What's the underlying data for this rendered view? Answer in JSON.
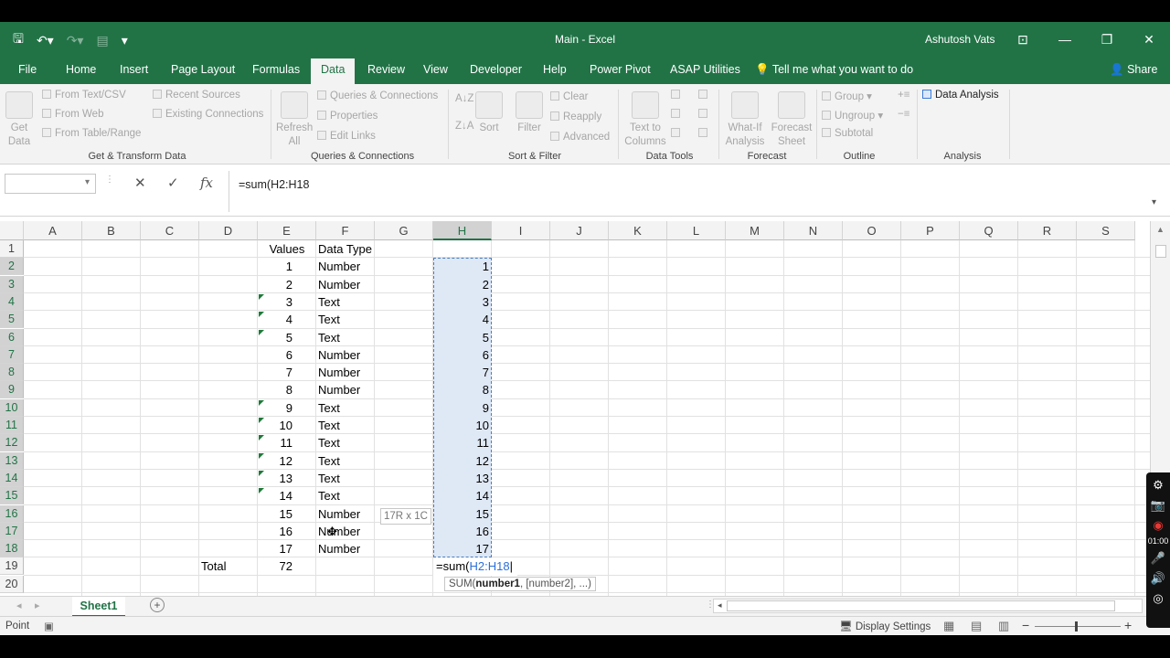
{
  "window": {
    "title": "Main  -  Excel",
    "user": "Ashutosh Vats"
  },
  "tabs": [
    "File",
    "Home",
    "Insert",
    "Page Layout",
    "Formulas",
    "Data",
    "Review",
    "View",
    "Developer",
    "Help",
    "Power Pivot",
    "ASAP Utilities"
  ],
  "active_tab": "Data",
  "tell_me": "Tell me what you want to do",
  "share": "Share",
  "ribbon": {
    "get_data": "Get Data",
    "from_text_csv": "From Text/CSV",
    "from_web": "From Web",
    "from_table_range": "From Table/Range",
    "recent_sources": "Recent Sources",
    "existing_connections": "Existing Connections",
    "group_get_transform": "Get & Transform Data",
    "refresh_all": "Refresh All",
    "queries_connections": "Queries & Connections",
    "properties": "Properties",
    "edit_links": "Edit Links",
    "group_queries": "Queries & Connections",
    "sort": "Sort",
    "filter": "Filter",
    "clear": "Clear",
    "reapply": "Reapply",
    "advanced": "Advanced",
    "group_sort_filter": "Sort & Filter",
    "text_to_columns": "Text to Columns",
    "group_data_tools": "Data Tools",
    "what_if": "What-If Analysis",
    "forecast_sheet": "Forecast Sheet",
    "group_forecast": "Forecast",
    "group": "Group",
    "ungroup": "Ungroup",
    "subtotal": "Subtotal",
    "group_outline": "Outline",
    "data_analysis": "Data Analysis",
    "group_analysis": "Analysis"
  },
  "formula_bar": {
    "name_box": "",
    "fx": "fx",
    "formula": "=sum(H2:H18"
  },
  "columns": [
    "A",
    "B",
    "C",
    "D",
    "E",
    "F",
    "G",
    "H",
    "I",
    "J",
    "K",
    "L",
    "M",
    "N",
    "O",
    "P",
    "Q",
    "R",
    "S"
  ],
  "rows": [
    "1",
    "2",
    "3",
    "4",
    "5",
    "6",
    "7",
    "8",
    "9",
    "10",
    "11",
    "12",
    "13",
    "14",
    "15",
    "16",
    "17",
    "18",
    "19",
    "20"
  ],
  "sheet": {
    "header_values": "Values",
    "header_type": "Data Type",
    "values": [
      "1",
      "2",
      "3",
      "4",
      "5",
      "6",
      "7",
      "8",
      "9",
      "10",
      "11",
      "12",
      "13",
      "14",
      "15",
      "16",
      "17"
    ],
    "types": [
      "Number",
      "Number",
      "Text",
      "Text",
      "Text",
      "Number",
      "Number",
      "Number",
      "Text",
      "Text",
      "Text",
      "Text",
      "Text",
      "Text",
      "Number",
      "Number",
      "Number"
    ],
    "text_flags": [
      false,
      false,
      true,
      true,
      true,
      false,
      false,
      false,
      true,
      true,
      true,
      true,
      true,
      true,
      false,
      false,
      false
    ],
    "h_values": [
      "1",
      "2",
      "3",
      "4",
      "5",
      "6",
      "7",
      "8",
      "9",
      "10",
      "11",
      "12",
      "13",
      "14",
      "15",
      "16",
      "17"
    ],
    "total_label": "Total",
    "total_value": "72",
    "edit_prefix": "=sum(",
    "edit_ref": "H2:H18"
  },
  "selection_tooltip": "17R x 1C",
  "function_hint": {
    "name": "SUM(",
    "arg1": "number1",
    "rest": ", [number2], ...)"
  },
  "sheet_tab": "Sheet1",
  "status": {
    "mode": "Point",
    "display_settings": "Display Settings"
  },
  "recorder_time": "01:00"
}
